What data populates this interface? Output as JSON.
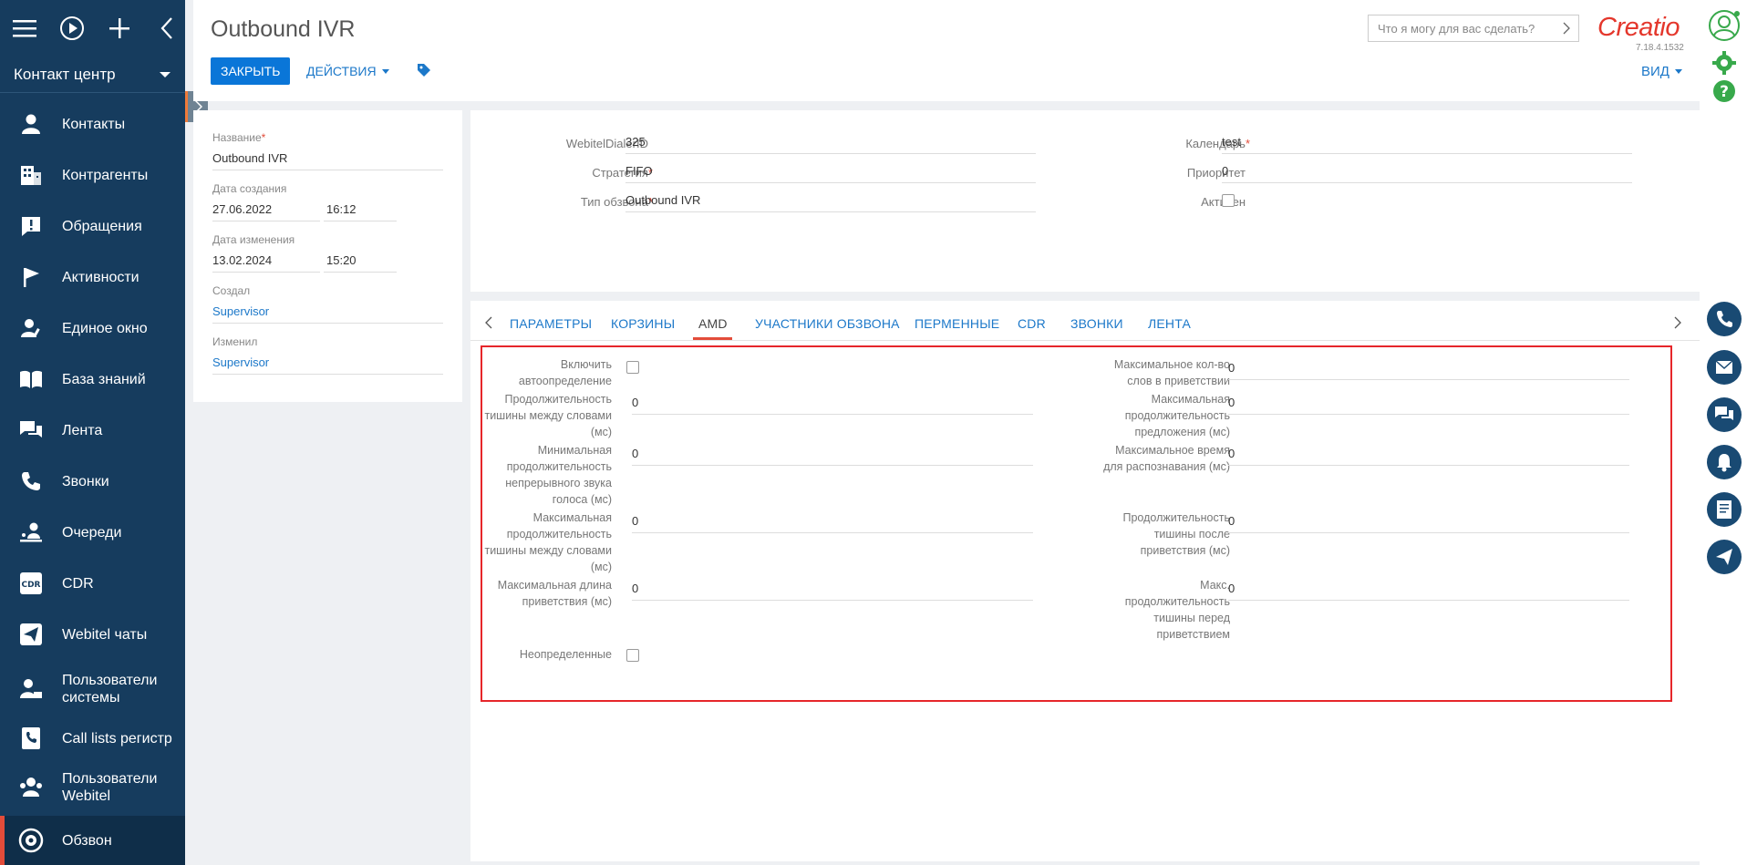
{
  "sidebar": {
    "section": "Контакт центр",
    "items": [
      {
        "label": "Контакты",
        "icon": "person-icon"
      },
      {
        "label": "Контрагенты",
        "icon": "building-icon"
      },
      {
        "label": "Обращения",
        "icon": "alert-icon"
      },
      {
        "label": "Активности",
        "icon": "flag-icon"
      },
      {
        "label": "Единое окно",
        "icon": "person-edit-icon"
      },
      {
        "label": "База знаний",
        "icon": "book-icon"
      },
      {
        "label": "Лента",
        "icon": "chat-icon"
      },
      {
        "label": "Звонки",
        "icon": "phone-icon"
      },
      {
        "label": "Очереди",
        "icon": "queue-icon"
      },
      {
        "label": "CDR",
        "icon": "cdr-icon"
      },
      {
        "label": "Webitel чаты",
        "icon": "send-icon"
      },
      {
        "label": "Пользователи системы",
        "icon": "user-lock-icon"
      },
      {
        "label": "Call lists регистр",
        "icon": "phone-book-icon"
      },
      {
        "label": "Пользователи Webitel",
        "icon": "users-icon"
      },
      {
        "label": "Обзвон",
        "icon": "dialer-icon"
      }
    ]
  },
  "header": {
    "title": "Outbound IVR",
    "close_label": "ЗАКРЫТЬ",
    "actions_label": "ДЕЙСТВИЯ",
    "search_placeholder": "Что я могу для вас сделать?",
    "logo": "Creatio",
    "version": "7.18.4.1532",
    "view_label": "ВИД"
  },
  "info": {
    "name_label": "Название",
    "name_value": "Outbound IVR",
    "created_label": "Дата создания",
    "created_date": "27.06.2022",
    "created_time": "16:12",
    "modified_label": "Дата изменения",
    "modified_date": "13.02.2024",
    "modified_time": "15:20",
    "creator_label": "Создал",
    "creator_value": "Supervisor",
    "modifier_label": "Изменил",
    "modifier_value": "Supervisor"
  },
  "main": {
    "dialer_id_label": "WebitelDialerID",
    "dialer_id_value": "325",
    "strategy_label": "Стратегия",
    "strategy_value": "FIFO",
    "type_label": "Тип обзвона",
    "type_value": "Outbound IVR",
    "calendar_label": "Календарь",
    "calendar_value": "test",
    "priority_label": "Приоритет",
    "priority_value": "0",
    "active_label": "Активен"
  },
  "tabs": [
    "ПАРАМЕТРЫ",
    "КОРЗИНЫ",
    "AMD",
    "УЧАСТНИКИ ОБЗВОНА",
    "ПЕРМЕННЫЕ",
    "CDR",
    "ЗВОНКИ",
    "ЛЕНТА"
  ],
  "amd": {
    "enable_label_1": "Включить",
    "enable_label_2": "автоопределение",
    "f1_l1": "Продолжительность",
    "f1_l2": "тишины между словами",
    "f1_l3": "(мс)",
    "f1_value": "0",
    "f2_l1": "Минимальная",
    "f2_l2": "продолжительность",
    "f2_l3": "непрерывного звука",
    "f2_l4": "голоса (мс)",
    "f2_value": "0",
    "f3_l1": "Максимальная",
    "f3_l2": "продолжительность",
    "f3_l3": "тишины между словами",
    "f3_l4": "(мс)",
    "f3_value": "0",
    "f4_l1": "Максимальная длина",
    "f4_l2": "приветствия (мс)",
    "f4_value": "0",
    "undefined_label": "Неопределенные",
    "r1_l1": "Максимальное кол-во",
    "r1_l2": "слов в приветствии",
    "r1_value": "0",
    "r2_l1": "Максимальная",
    "r2_l2": "продолжительность",
    "r2_l3": "предложения (мс)",
    "r2_value": "0",
    "r3_l1": "Максимальное время",
    "r3_l2": "для распознавания (мс)",
    "r3_value": "0",
    "r4_l1": "Продолжительность",
    "r4_l2": "тишины после",
    "r4_l3": "приветствия (мс)",
    "r4_value": "0",
    "r5_l1": "Макс.",
    "r5_l2": "продолжительность",
    "r5_l3": "тишины перед",
    "r5_l4": "приветствием",
    "r5_value": "0"
  }
}
